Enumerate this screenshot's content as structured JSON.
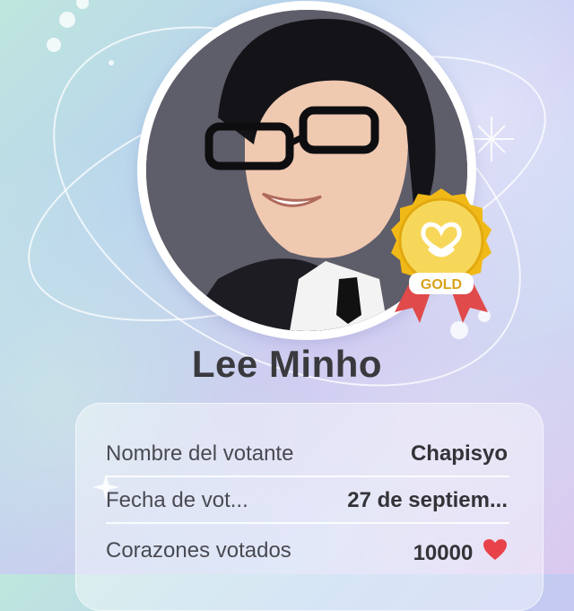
{
  "profile": {
    "name": "Lee Minho",
    "badge": {
      "label": "GOLD",
      "icon": "heart-icon"
    }
  },
  "vote_info": {
    "rows": [
      {
        "label": "Nombre del votante",
        "value": "Chapisyo"
      },
      {
        "label": "Fecha de vot...",
        "value": "27 de septiem..."
      },
      {
        "label": "Corazones votados",
        "value": "10000",
        "icon": "red-heart-icon"
      }
    ]
  },
  "colors": {
    "gold": "#f2c11e",
    "ribbon": "#e04a4a",
    "heart": "#e8434b",
    "text": "#3a3a3e"
  }
}
